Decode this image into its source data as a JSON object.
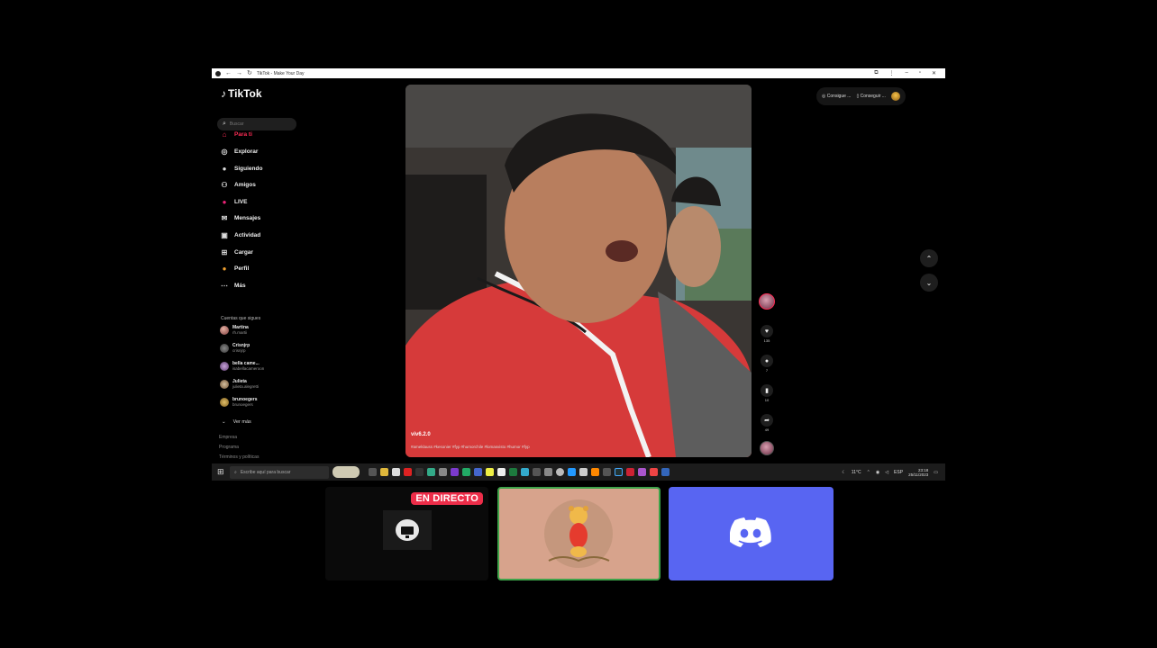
{
  "browser": {
    "title": "TikTok - Make Your Day"
  },
  "tiktok": {
    "logo": "TikTok",
    "search_placeholder": "Buscar",
    "nav": [
      {
        "label": "Para ti",
        "icon": "home-icon",
        "active": true
      },
      {
        "label": "Explorar",
        "icon": "compass-icon",
        "active": false
      },
      {
        "label": "Siguiendo",
        "icon": "following-icon",
        "active": false
      },
      {
        "label": "Amigos",
        "icon": "friends-icon",
        "active": false
      },
      {
        "label": "LIVE",
        "icon": "live-icon",
        "active": false
      },
      {
        "label": "Mensajes",
        "icon": "messages-icon",
        "active": false
      },
      {
        "label": "Actividad",
        "icon": "activity-icon",
        "active": false
      },
      {
        "label": "Cargar",
        "icon": "upload-icon",
        "active": false
      },
      {
        "label": "Perfil",
        "icon": "profile-icon",
        "active": false
      },
      {
        "label": "Más",
        "icon": "more-icon",
        "active": false
      }
    ],
    "following_title": "Cuentas que sigues",
    "accounts": [
      {
        "name": "Martina",
        "handle": "rh.martii"
      },
      {
        "name": "Crisnjrp",
        "handle": "crisnjrp"
      },
      {
        "name": "bella came...",
        "handle": "isabellacameroon"
      },
      {
        "name": "Julieta",
        "handle": "julieta.alegretti"
      },
      {
        "name": "brunoegers",
        "handle": "brunoegers"
      }
    ],
    "see_more": "Ver más",
    "footer_links": [
      "Empresa",
      "Programa",
      "Términos y políticas"
    ],
    "video": {
      "username": "viv6.2.0",
      "caption": "#ameklauss                                   #kesonier #fyp #humorchile #lomasvisto #humor #fyp"
    },
    "actions": {
      "likes": "135",
      "comments": "7",
      "saves": "10",
      "shares": "49"
    },
    "top_buttons": [
      "Consigue ...",
      "Conseguir ..."
    ]
  },
  "taskbar": {
    "search_placeholder": "Escribe aquí para buscar",
    "weather": "11°C",
    "language": "ESP",
    "time": "23:18",
    "date": "25/11/2023"
  },
  "tiles": {
    "live_badge": "EN DIRECTO"
  }
}
